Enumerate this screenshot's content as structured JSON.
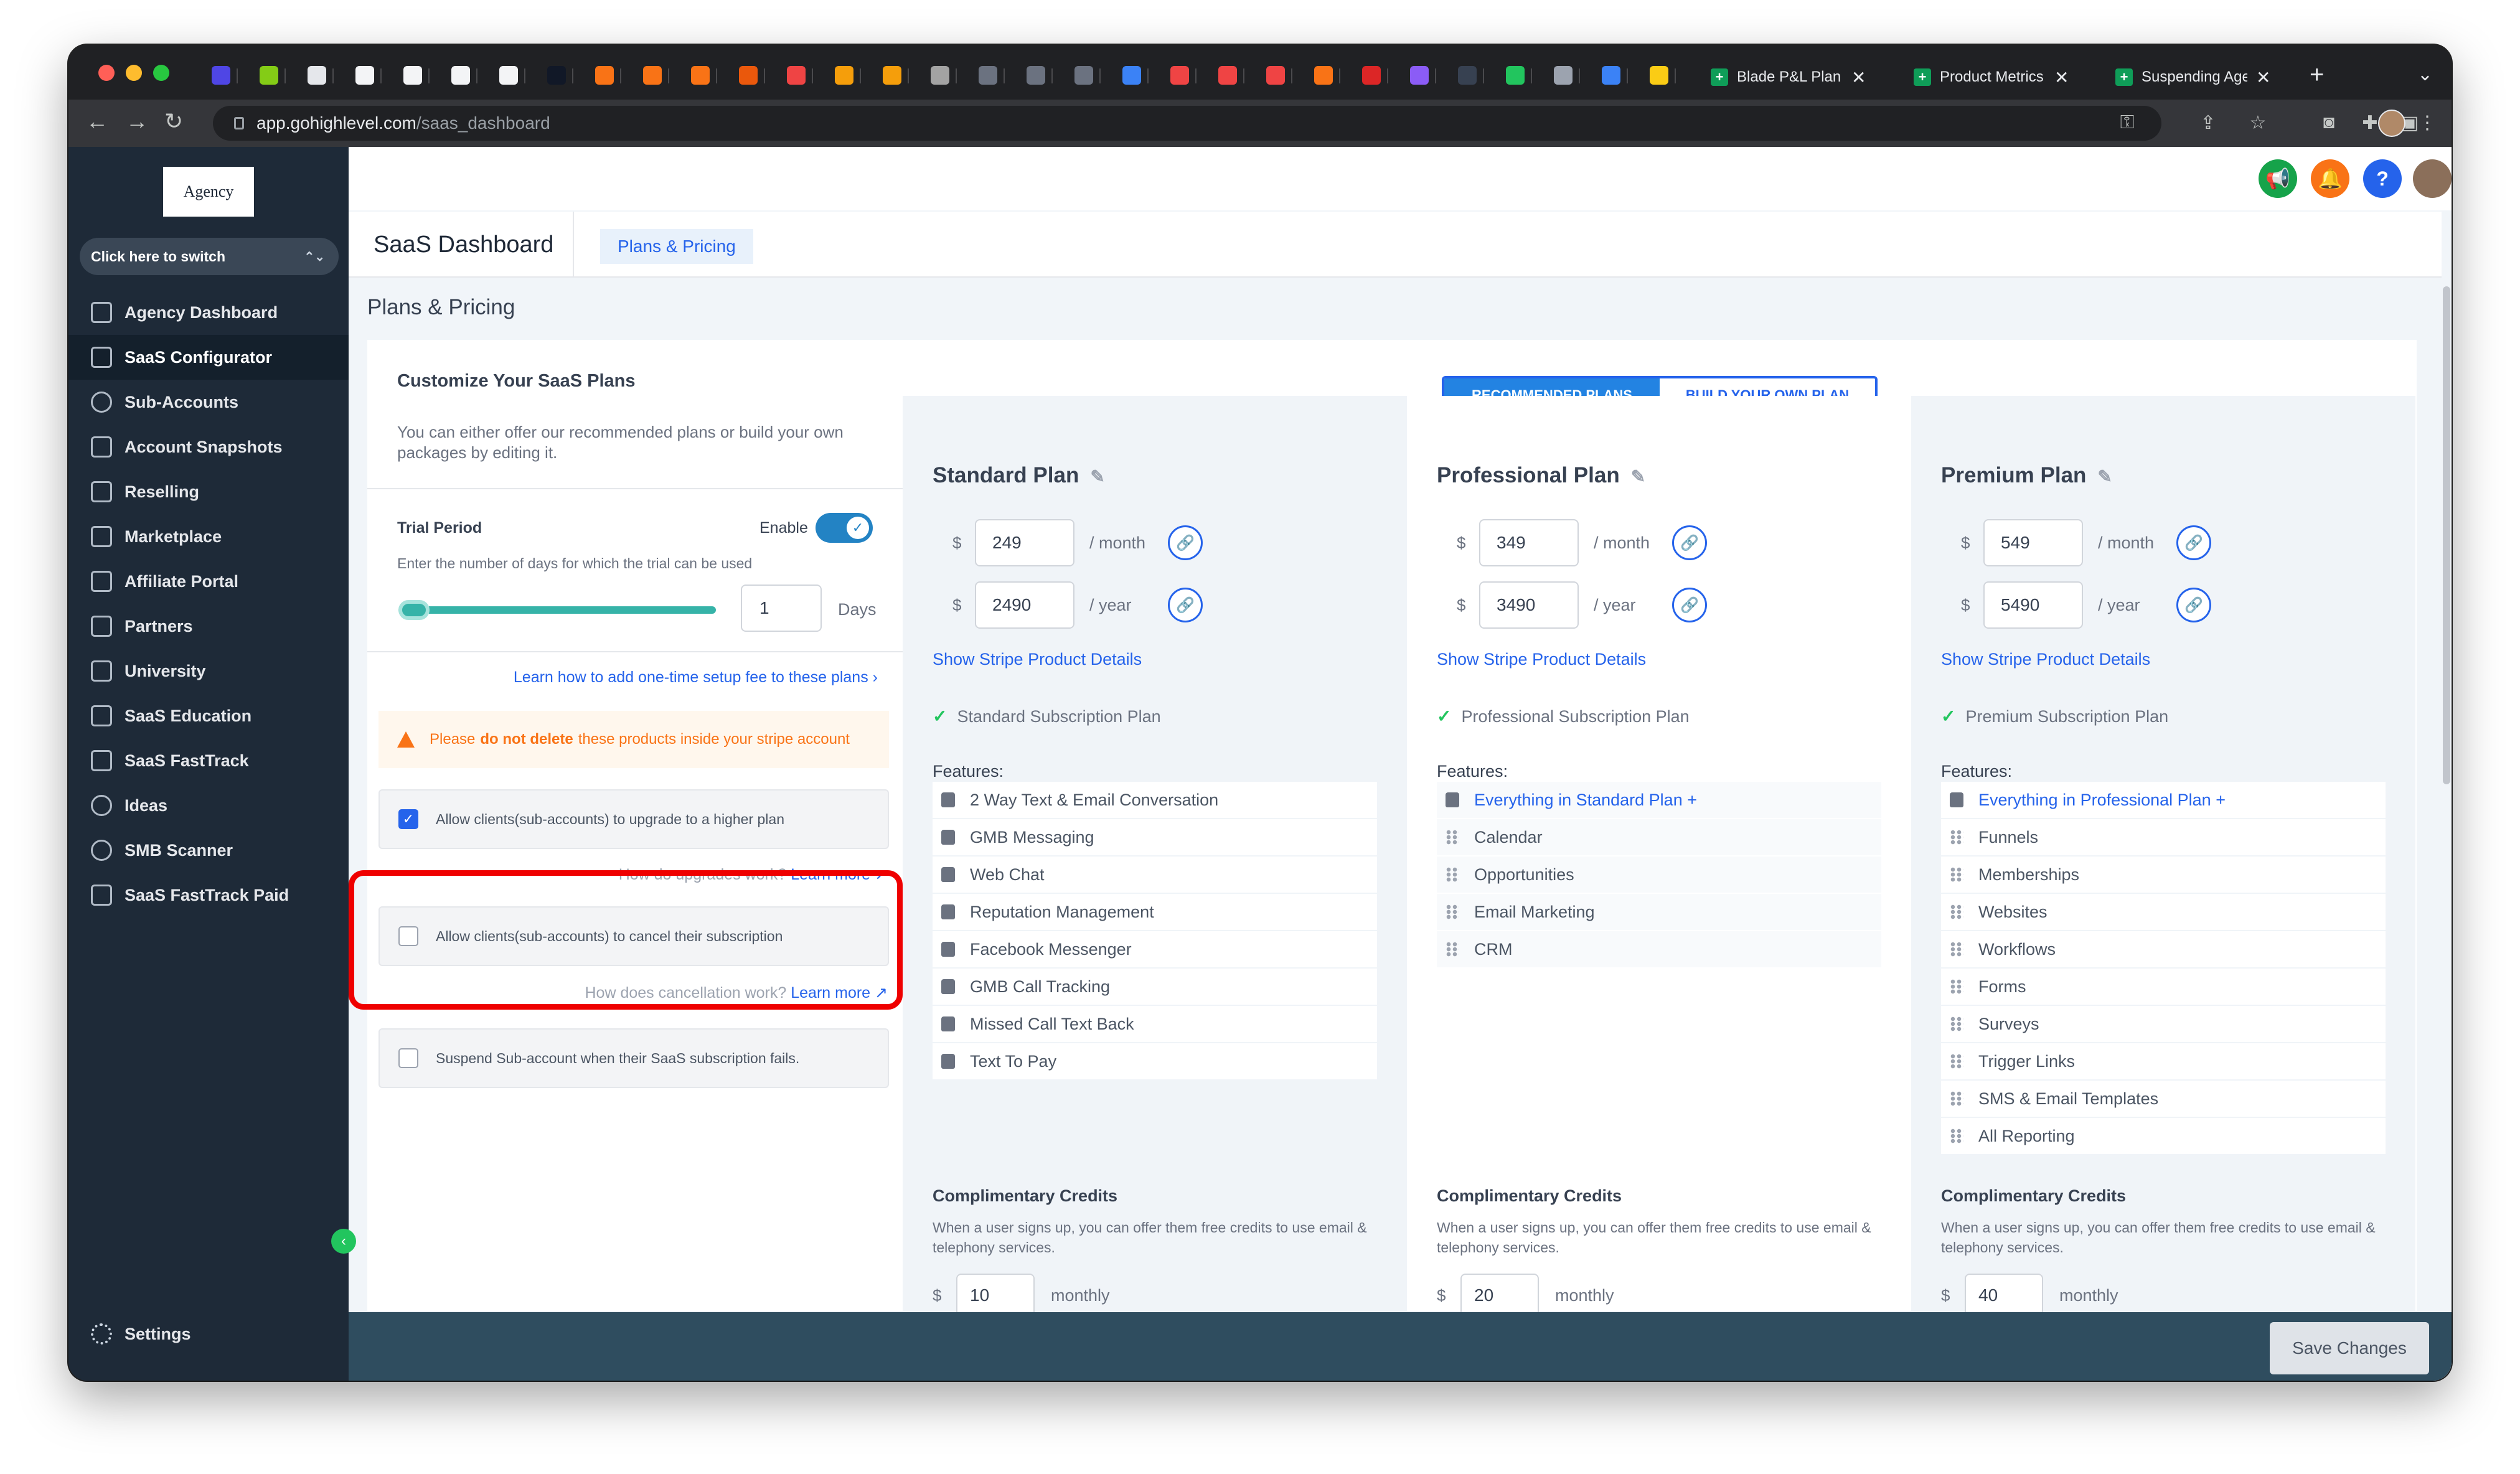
{
  "browser": {
    "tabs": [
      {
        "label": "Blade P&L Plan -"
      },
      {
        "label": "Product Metrics -"
      },
      {
        "label": "Suspending Agen"
      }
    ],
    "new_tab_label": "+",
    "url_host": "app.gohighlevel.com",
    "url_path": "/saas_dashboard"
  },
  "sidebar": {
    "logo_text": "Agency",
    "switcher_label": "Click here to switch",
    "items": [
      {
        "label": "Agency Dashboard",
        "active": false
      },
      {
        "label": "SaaS Configurator",
        "active": true
      },
      {
        "label": "Sub-Accounts",
        "active": false
      },
      {
        "label": "Account Snapshots",
        "active": false
      },
      {
        "label": "Reselling",
        "active": false
      },
      {
        "label": "Marketplace",
        "active": false
      },
      {
        "label": "Affiliate Portal",
        "active": false
      },
      {
        "label": "Partners",
        "active": false
      },
      {
        "label": "University",
        "active": false
      },
      {
        "label": "SaaS Education",
        "active": false
      },
      {
        "label": "SaaS FastTrack",
        "active": false
      },
      {
        "label": "Ideas",
        "active": false
      },
      {
        "label": "SMB Scanner",
        "active": false
      },
      {
        "label": "SaaS FastTrack Paid",
        "active": false
      }
    ],
    "settings_label": "Settings"
  },
  "header": {
    "title": "SaaS Dashboard",
    "tab_label": "Plans & Pricing",
    "help_glyph": "?"
  },
  "page": {
    "title": "Plans & Pricing"
  },
  "customize": {
    "title": "Customize Your SaaS Plans",
    "description": "You can either offer our recommended plans or build your own packages by editing it.",
    "trial_label": "Trial Period",
    "enable_label": "Enable",
    "trial_enabled": true,
    "trial_help": "Enter the number of days for which the trial can be used",
    "trial_days": "1",
    "days_label": "Days",
    "setup_fee_link": "Learn how to add one-time setup fee to these plans",
    "warning_pre": "Please",
    "warning_bold": "do not delete",
    "warning_post": "these products inside your stripe account",
    "upgrade_label": "Allow clients(sub-accounts) to upgrade to a higher plan",
    "upgrade_checked": true,
    "upgrade_help": "How do upgrades work?",
    "cancel_label": "Allow clients(sub-accounts) to cancel their subscription",
    "cancel_checked": false,
    "cancel_help": "How does cancellation work?",
    "learn_more": "Learn more",
    "suspend_label": "Suspend Sub-account when their SaaS subscription fails.",
    "suspend_checked": false
  },
  "plan_toggle": {
    "recommended": "RECOMMENDED PLANS",
    "build": "BUILD YOUR OWN PLAN"
  },
  "common": {
    "currency": "$",
    "per_month": "/ month",
    "per_year": "/ year",
    "stripe_link": "Show Stripe Product Details",
    "features_label": "Features:",
    "credits_title": "Complimentary Credits",
    "credits_desc": "When a user signs up, you can offer them free credits to use email & telephony services.",
    "monthly_label": "monthly"
  },
  "plans": [
    {
      "name": "Standard Plan",
      "monthly_price": "249",
      "yearly_price": "2490",
      "subscription_name": "Standard Subscription Plan",
      "features": [
        "2 Way Text & Email Conversation",
        "GMB Messaging",
        "Web Chat",
        "Reputation Management",
        "Facebook Messenger",
        "GMB Call Tracking",
        "Missed Call Text Back",
        "Text To Pay"
      ],
      "credits": "10"
    },
    {
      "name": "Professional Plan",
      "monthly_price": "349",
      "yearly_price": "3490",
      "subscription_name": "Professional Subscription Plan",
      "features": [
        "Everything in Standard Plan +",
        "Calendar",
        "Opportunities",
        "Email Marketing",
        "CRM"
      ],
      "credits": "20"
    },
    {
      "name": "Premium Plan",
      "monthly_price": "549",
      "yearly_price": "5490",
      "subscription_name": "Premium Subscription Plan",
      "features": [
        "Everything in Professional Plan +",
        "Funnels",
        "Memberships",
        "Websites",
        "Workflows",
        "Forms",
        "Surveys",
        "Trigger Links",
        "SMS & Email Templates",
        "All Reporting"
      ],
      "credits": "40"
    }
  ],
  "footer": {
    "save_label": "Save Changes"
  },
  "colors": {
    "accent": "#2563eb",
    "sidebar_bg": "#1e2a38",
    "footer_bg": "#2f4d5f",
    "highlight_box": "#ef0000",
    "warning": "#f97316"
  }
}
